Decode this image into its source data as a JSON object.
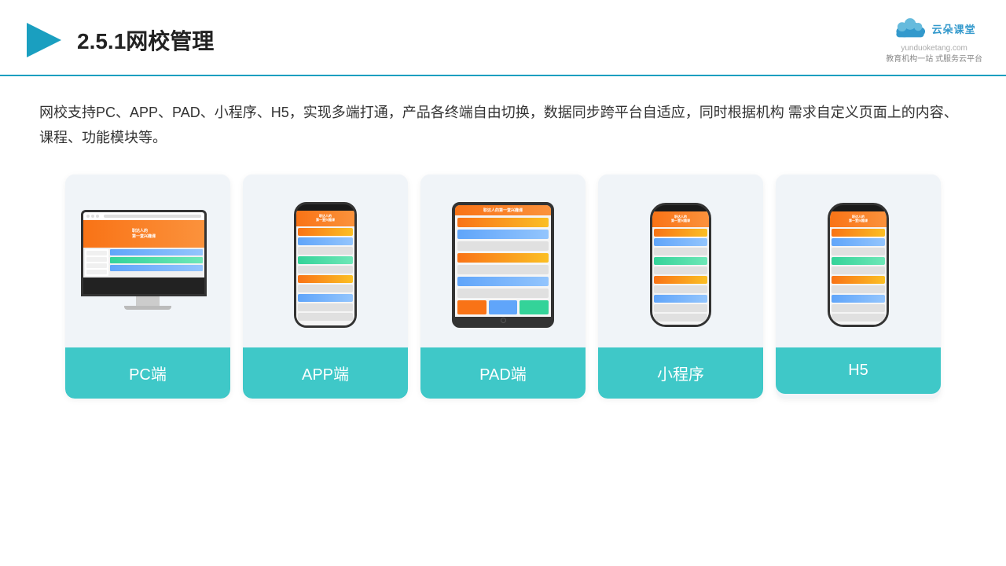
{
  "header": {
    "title": "2.5.1网校管理",
    "logo": {
      "name": "云朵课堂",
      "url": "yunduoketang.com",
      "tagline": "教育机构一站\n式服务云平台"
    }
  },
  "description": "网校支持PC、APP、PAD、小程序、H5，实现多端打通，产品各终端自由切换，数据同步跨平台自适应，同时根据机构\n需求自定义页面上的内容、课程、功能模块等。",
  "cards": [
    {
      "id": "pc",
      "label": "PC端"
    },
    {
      "id": "app",
      "label": "APP端"
    },
    {
      "id": "pad",
      "label": "PAD端"
    },
    {
      "id": "miniprogram",
      "label": "小程序"
    },
    {
      "id": "h5",
      "label": "H5"
    }
  ]
}
